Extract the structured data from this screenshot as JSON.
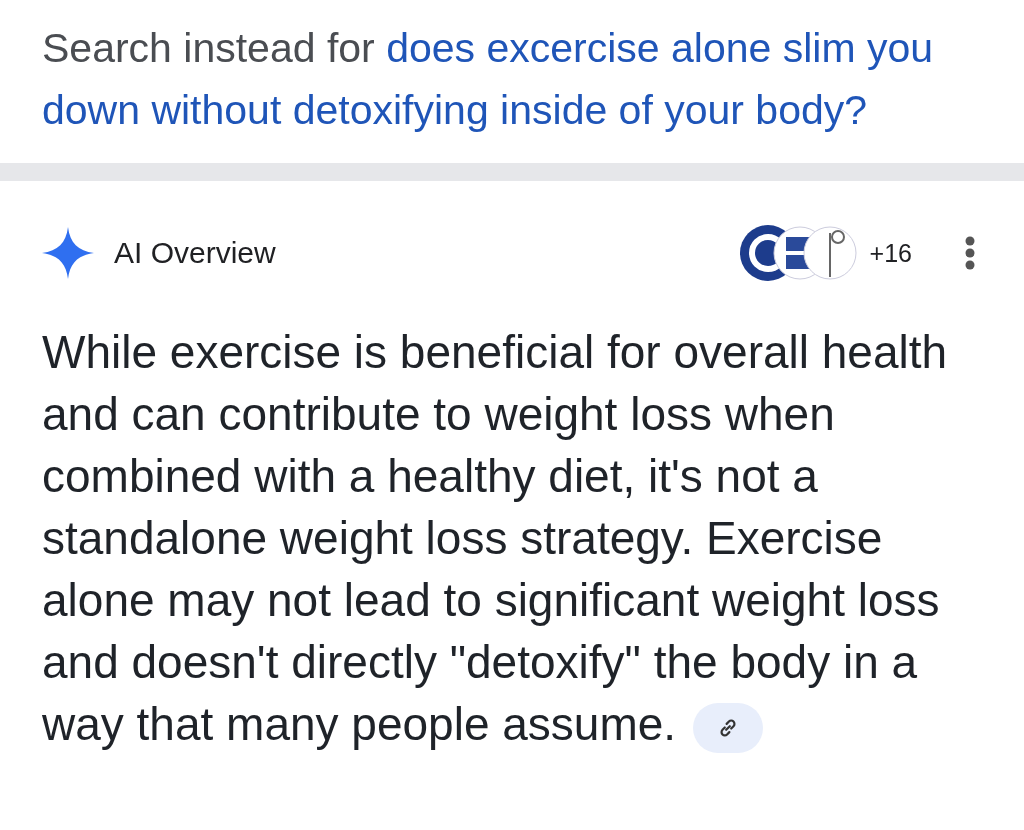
{
  "spelling": {
    "prefix": "Search instead for",
    "link_lines": [
      "does excercise alone slim you",
      "down without detoxifying inside of your body?"
    ]
  },
  "ai_overview": {
    "title": "AI Overview",
    "sources_more": "+16",
    "body": "While exercise is beneficial for overall health and can contribute to weight loss when combined with a healthy diet, it's not a standalone weight loss strategy. Exercise alone may not lead to significant weight loss and doesn't directly \"detoxify\" the body in a way that many people assume."
  }
}
